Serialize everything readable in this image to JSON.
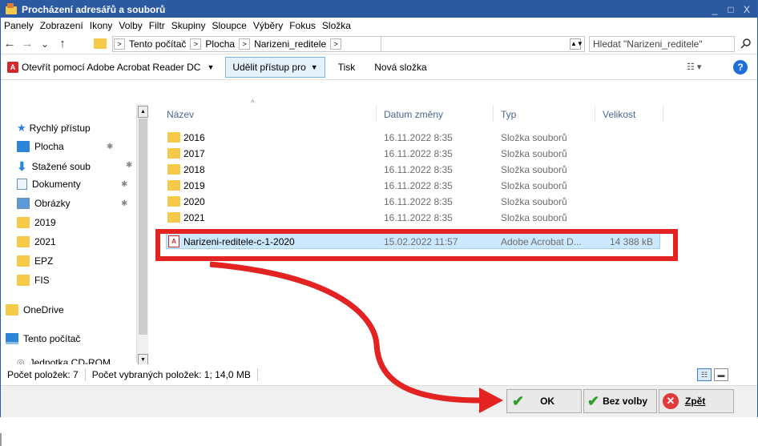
{
  "window": {
    "title": "Procházení adresářů a souborů",
    "minimize": "_",
    "maximize": "□",
    "close": "X"
  },
  "menu": [
    "Panely",
    "Zobrazení",
    "Ikony",
    "Volby",
    "Filtr",
    "Skupiny",
    "Sloupce",
    "Výběry",
    "Fokus",
    "Složka"
  ],
  "nav": {
    "back": "←",
    "forward": "→",
    "recent": "⌄",
    "up": "↑"
  },
  "breadcrumb": [
    "Tento počítač",
    "Plocha",
    "Narizeni_reditele"
  ],
  "breadcrumb_sep": ">",
  "search": {
    "placeholder": "Hledat \"Narizeni_reditele\""
  },
  "toolbar": {
    "open_with": "Otevřít pomocí Adobe Acrobat Reader DC",
    "share": "Udělit přístup pro",
    "print": "Tisk",
    "new_folder": "Nová složka",
    "dropdown": "▼",
    "help": "?"
  },
  "sidebar": {
    "quick_access": "Rychlý přístup",
    "items": [
      {
        "label": "Plocha",
        "icon": "desktop-icon"
      },
      {
        "label": "Stažené soub",
        "icon": "download-icon"
      },
      {
        "label": "Dokumenty",
        "icon": "documents-icon"
      },
      {
        "label": "Obrázky",
        "icon": "pictures-icon"
      },
      {
        "label": "2019",
        "icon": "folder-icon"
      },
      {
        "label": "2021",
        "icon": "folder-icon"
      },
      {
        "label": "EPZ",
        "icon": "folder-icon"
      },
      {
        "label": "FIS",
        "icon": "folder-icon"
      }
    ],
    "onedrive": "OneDrive",
    "this_pc": "Tento počítač",
    "cd_rom": "Jednotka CD-ROM"
  },
  "columns": {
    "name": "Název",
    "date": "Datum změny",
    "type": "Typ",
    "size": "Velikost"
  },
  "files": [
    {
      "name": "2016",
      "date": "16.11.2022 8:35",
      "type": "Složka souborů",
      "size": ""
    },
    {
      "name": "2017",
      "date": "16.11.2022 8:35",
      "type": "Složka souborů",
      "size": ""
    },
    {
      "name": "2018",
      "date": "16.11.2022 8:35",
      "type": "Složka souborů",
      "size": ""
    },
    {
      "name": "2019",
      "date": "16.11.2022 8:35",
      "type": "Složka souborů",
      "size": ""
    },
    {
      "name": "2020",
      "date": "16.11.2022 8:35",
      "type": "Složka souborů",
      "size": ""
    },
    {
      "name": "2021",
      "date": "16.11.2022 8:35",
      "type": "Složka souborů",
      "size": ""
    },
    {
      "name": "Narizeni-reditele-c-1-2020",
      "date": "15.02.2022 11:57",
      "type": "Adobe Acrobat D...",
      "size": "14 388 kB"
    }
  ],
  "status": {
    "count": "Počet položek: 7",
    "selected": "Počet vybraných položek: 1; 14,0 MB"
  },
  "buttons": {
    "ok": "OK",
    "none": "Bez volby",
    "back": "Zpět"
  },
  "colors": {
    "titlebar": "#2c5aa0",
    "highlight": "#e32222",
    "selection": "#cce8ff",
    "header_text": "#4a6791"
  }
}
